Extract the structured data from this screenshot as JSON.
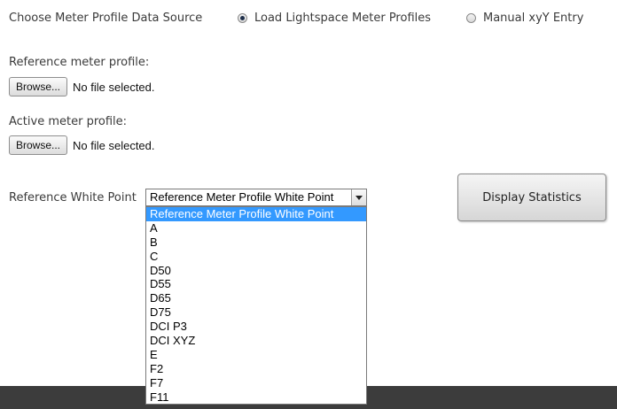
{
  "source": {
    "label": "Choose Meter Profile Data Source",
    "options": [
      {
        "label": "Load Lightspace Meter Profiles",
        "checked": true
      },
      {
        "label": "Manual xyY Entry",
        "checked": false
      }
    ]
  },
  "reference_profile": {
    "label": "Reference meter profile:",
    "browse_label": "Browse...",
    "status": "No file selected."
  },
  "active_profile": {
    "label": "Active meter profile:",
    "browse_label": "Browse...",
    "status": "No file selected."
  },
  "white_point": {
    "label": "Reference White Point",
    "selected": "Reference Meter Profile White Point",
    "options": [
      "Reference Meter Profile White Point",
      "A",
      "B",
      "C",
      "D50",
      "D55",
      "D65",
      "D75",
      "DCI P3",
      "DCI XYZ",
      "E",
      "F2",
      "F7",
      "F11"
    ]
  },
  "display_button": {
    "label": "Display Statistics"
  },
  "colors": {
    "highlight": "#3399ff",
    "footer": "#3c3c3c"
  }
}
